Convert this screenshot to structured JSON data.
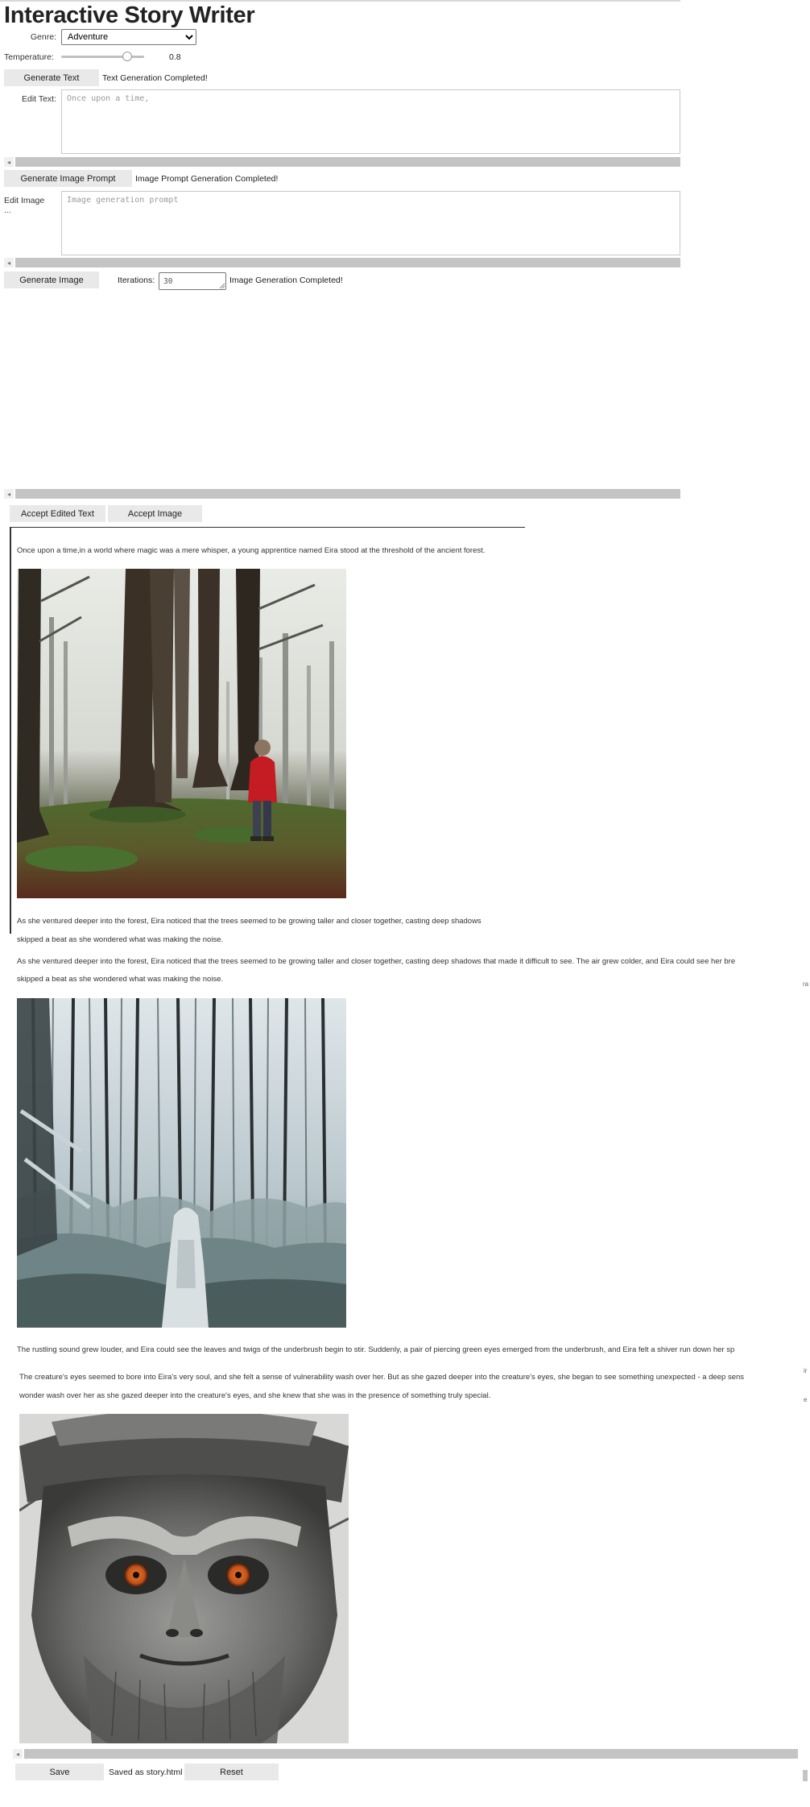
{
  "app": {
    "title": "Interactive Story Writer"
  },
  "controls": {
    "genre_label": "Genre:",
    "genre_value": "Adventure",
    "temperature_label": "Temperature:",
    "temperature_value": "0.8",
    "temperature_fraction": 0.8,
    "generate_text_label": "Generate Text",
    "text_status": "Text Generation Completed!",
    "edit_text_label": "Edit Text:",
    "edit_text_placeholder": "Once upon a time,",
    "generate_prompt_label": "Generate Image Prompt",
    "prompt_status": "Image Prompt Generation Completed!",
    "edit_image_label": "Edit Image ...",
    "edit_image_placeholder": "Image generation prompt",
    "generate_image_label": "Generate Image",
    "iterations_label": "Iterations:",
    "iterations_value": "30",
    "image_status": "Image Generation Completed!"
  },
  "actions": {
    "accept_text_label": "Accept Edited Text",
    "accept_image_label": "Accept Image"
  },
  "story": {
    "p1": "Once upon a time,in a world where magic was a mere whisper, a young apprentice named Eira stood at the threshold of the ancient forest.",
    "p2a_line1": "As she ventured deeper into the forest, Eira noticed that the trees seemed to be growing taller and closer together, casting deep shadows",
    "p2a_line2": "skipped a beat as she wondered what was making the noise.",
    "p2b_line1": "As she ventured deeper into the forest, Eira noticed that the trees seemed to be growing taller and closer together, casting deep shadows that made it difficult to see. The air grew colder, and Eira could see her bre",
    "p2b_line2": "skipped a beat as she wondered what was making the noise.",
    "p3": "The rustling sound grew louder, and Eira could see the leaves and twigs of the underbrush begin to stir. Suddenly, a pair of piercing green eyes emerged from the underbrush, and Eira felt a shiver run down her sp",
    "p4_line1": "The creature's eyes seemed to bore into Eira's very soul, and she felt a sense of vulnerability wash over her. But as she gazed deeper into the creature's eyes, she began to see something unexpected - a deep sens",
    "p4_line2": "wonder wash over her as she gazed deeper into the creature's eyes, and she knew that she was in the presence of something truly special."
  },
  "footer": {
    "save_label": "Save",
    "save_status": "Saved as story.html",
    "reset_label": "Reset"
  },
  "side_marks": {
    "m1": "ra",
    "m2": "ir",
    "m3": "e"
  },
  "colors": {
    "button_bg": "#e9e9e9",
    "scrollbar": "#c4c4c4",
    "red_coat": "#c41c22",
    "eye_orange": "#c4521c"
  },
  "icons": {
    "scroll_left": "◂",
    "dropdown": "chevron-down-icon",
    "resize_handle": "resize-grip-icon"
  }
}
